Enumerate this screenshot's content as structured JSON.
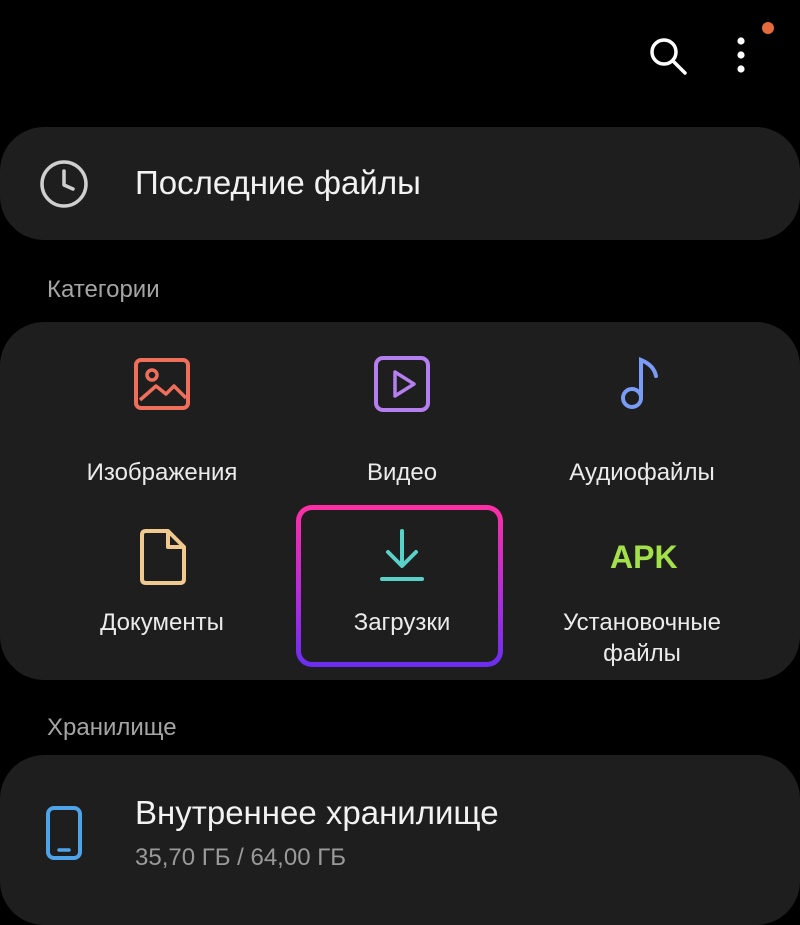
{
  "header": {
    "icons": [
      "search-icon",
      "more-vert-icon"
    ],
    "notification_dot_color": "#e56b3d"
  },
  "recent": {
    "label": "Последние файлы",
    "icon": "clock-icon"
  },
  "categories": {
    "title": "Категории",
    "items": [
      {
        "label": "Изображения",
        "icon": "image-icon",
        "color": "#ef6f5c"
      },
      {
        "label": "Видео",
        "icon": "video-icon",
        "color": "#b57ff0"
      },
      {
        "label": "Аудиофайлы",
        "icon": "music-note-icon",
        "color": "#7a9cf6"
      },
      {
        "label": "Документы",
        "icon": "document-icon",
        "color": "#f0c98f"
      },
      {
        "label": "Загрузки",
        "icon": "download-icon",
        "color": "#59d1c8",
        "highlighted": true
      },
      {
        "label": "Установочные\nфайлы",
        "icon": "APK",
        "color": "#a3e04a"
      }
    ]
  },
  "storage": {
    "title": "Хранилище",
    "internal": {
      "label": "Внутреннее хранилище",
      "usage": "35,70 ГБ / 64,00 ГБ",
      "icon": "phone-icon",
      "color": "#4fa3e8"
    }
  }
}
